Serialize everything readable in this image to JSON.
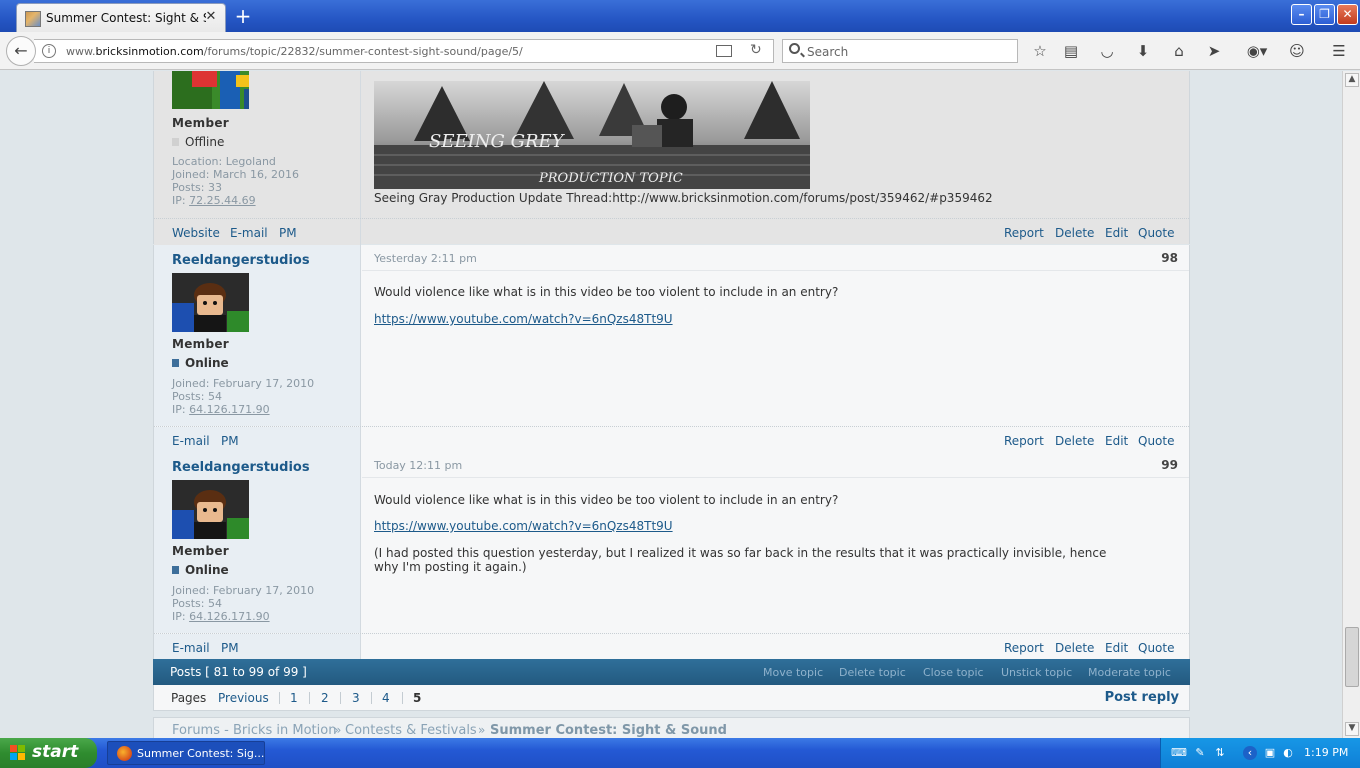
{
  "browser": {
    "tab_title": "Summer Contest: Sight & Sou...",
    "url_prefix": "www.",
    "url_domain": "bricksinmotion.com",
    "url_path": "/forums/topic/22832/summer-contest-sight-sound/page/5/",
    "search_placeholder": "Search"
  },
  "post_top": {
    "rank": "Member",
    "status": "Offline",
    "location": "Location: Legoland",
    "joined": "Joined: March 16, 2016",
    "posts": "Posts: 33",
    "ip_label": "IP: ",
    "ip": "72.25.44.69",
    "banner_line1": "SEEING GREY",
    "banner_line2": "PRODUCTION TOPIC",
    "signature": "Seeing Gray Production Update Thread:http://www.bricksinmotion.com/forums/post/359462/#p359462",
    "side_links": [
      "Website",
      "E-mail",
      "PM"
    ]
  },
  "post_98": {
    "username": "Reeldangerstudios",
    "date": "Yesterday 2:11 pm",
    "number": "98",
    "rank": "Member",
    "status": "Online",
    "joined": "Joined: February 17, 2010",
    "posts": "Posts: 54",
    "ip_label": "IP: ",
    "ip": "64.126.171.90",
    "message": "Would violence like what is in this video be too violent to include in an entry?",
    "link": "https://www.youtube.com/watch?v=6nQzs48Tt9U",
    "side_links": [
      "E-mail",
      "PM"
    ]
  },
  "post_99": {
    "username": "Reeldangerstudios",
    "date": "Today 12:11 pm",
    "number": "99",
    "rank": "Member",
    "status": "Online",
    "joined": "Joined: February 17, 2010",
    "posts": "Posts: 54",
    "ip_label": "IP: ",
    "ip": "64.126.171.90",
    "message": "Would violence like what is in this video be too violent to include in an entry?",
    "link": "https://www.youtube.com/watch?v=6nQzs48Tt9U",
    "message2_line1": "(I had posted this question yesterday, but I realized it was so far back in the results that it was practically invisible, hence",
    "message2_line2": "why I'm posting it again.)",
    "side_links": [
      "E-mail",
      "PM"
    ]
  },
  "post_actions": [
    "Report",
    "Delete",
    "Edit",
    "Quote"
  ],
  "topic_bar": {
    "posts_count": "Posts [ 81 to 99 of 99 ]",
    "mod_links": [
      "Move topic",
      "Delete topic",
      "Close topic",
      "Unstick topic",
      "Moderate topic"
    ]
  },
  "pagination": {
    "label": "Pages",
    "previous": "Previous",
    "pages": [
      "1",
      "2",
      "3",
      "4"
    ],
    "current": "5",
    "post_reply": "Post reply"
  },
  "breadcrumb": {
    "items": [
      "Forums - Bricks in Motion",
      "Contests & Festivals"
    ],
    "current": "Summer Contest: Sight & Sound",
    "separator": "»"
  },
  "taskbar": {
    "start": "start",
    "task_label": "Summer Contest: Sig...",
    "clock": "1:19 PM"
  },
  "colors": {
    "link": "#1d5a8a",
    "online": "#3d6e9a",
    "offline": "#c8c8c8",
    "topic_bar": "#2f6f9a"
  }
}
